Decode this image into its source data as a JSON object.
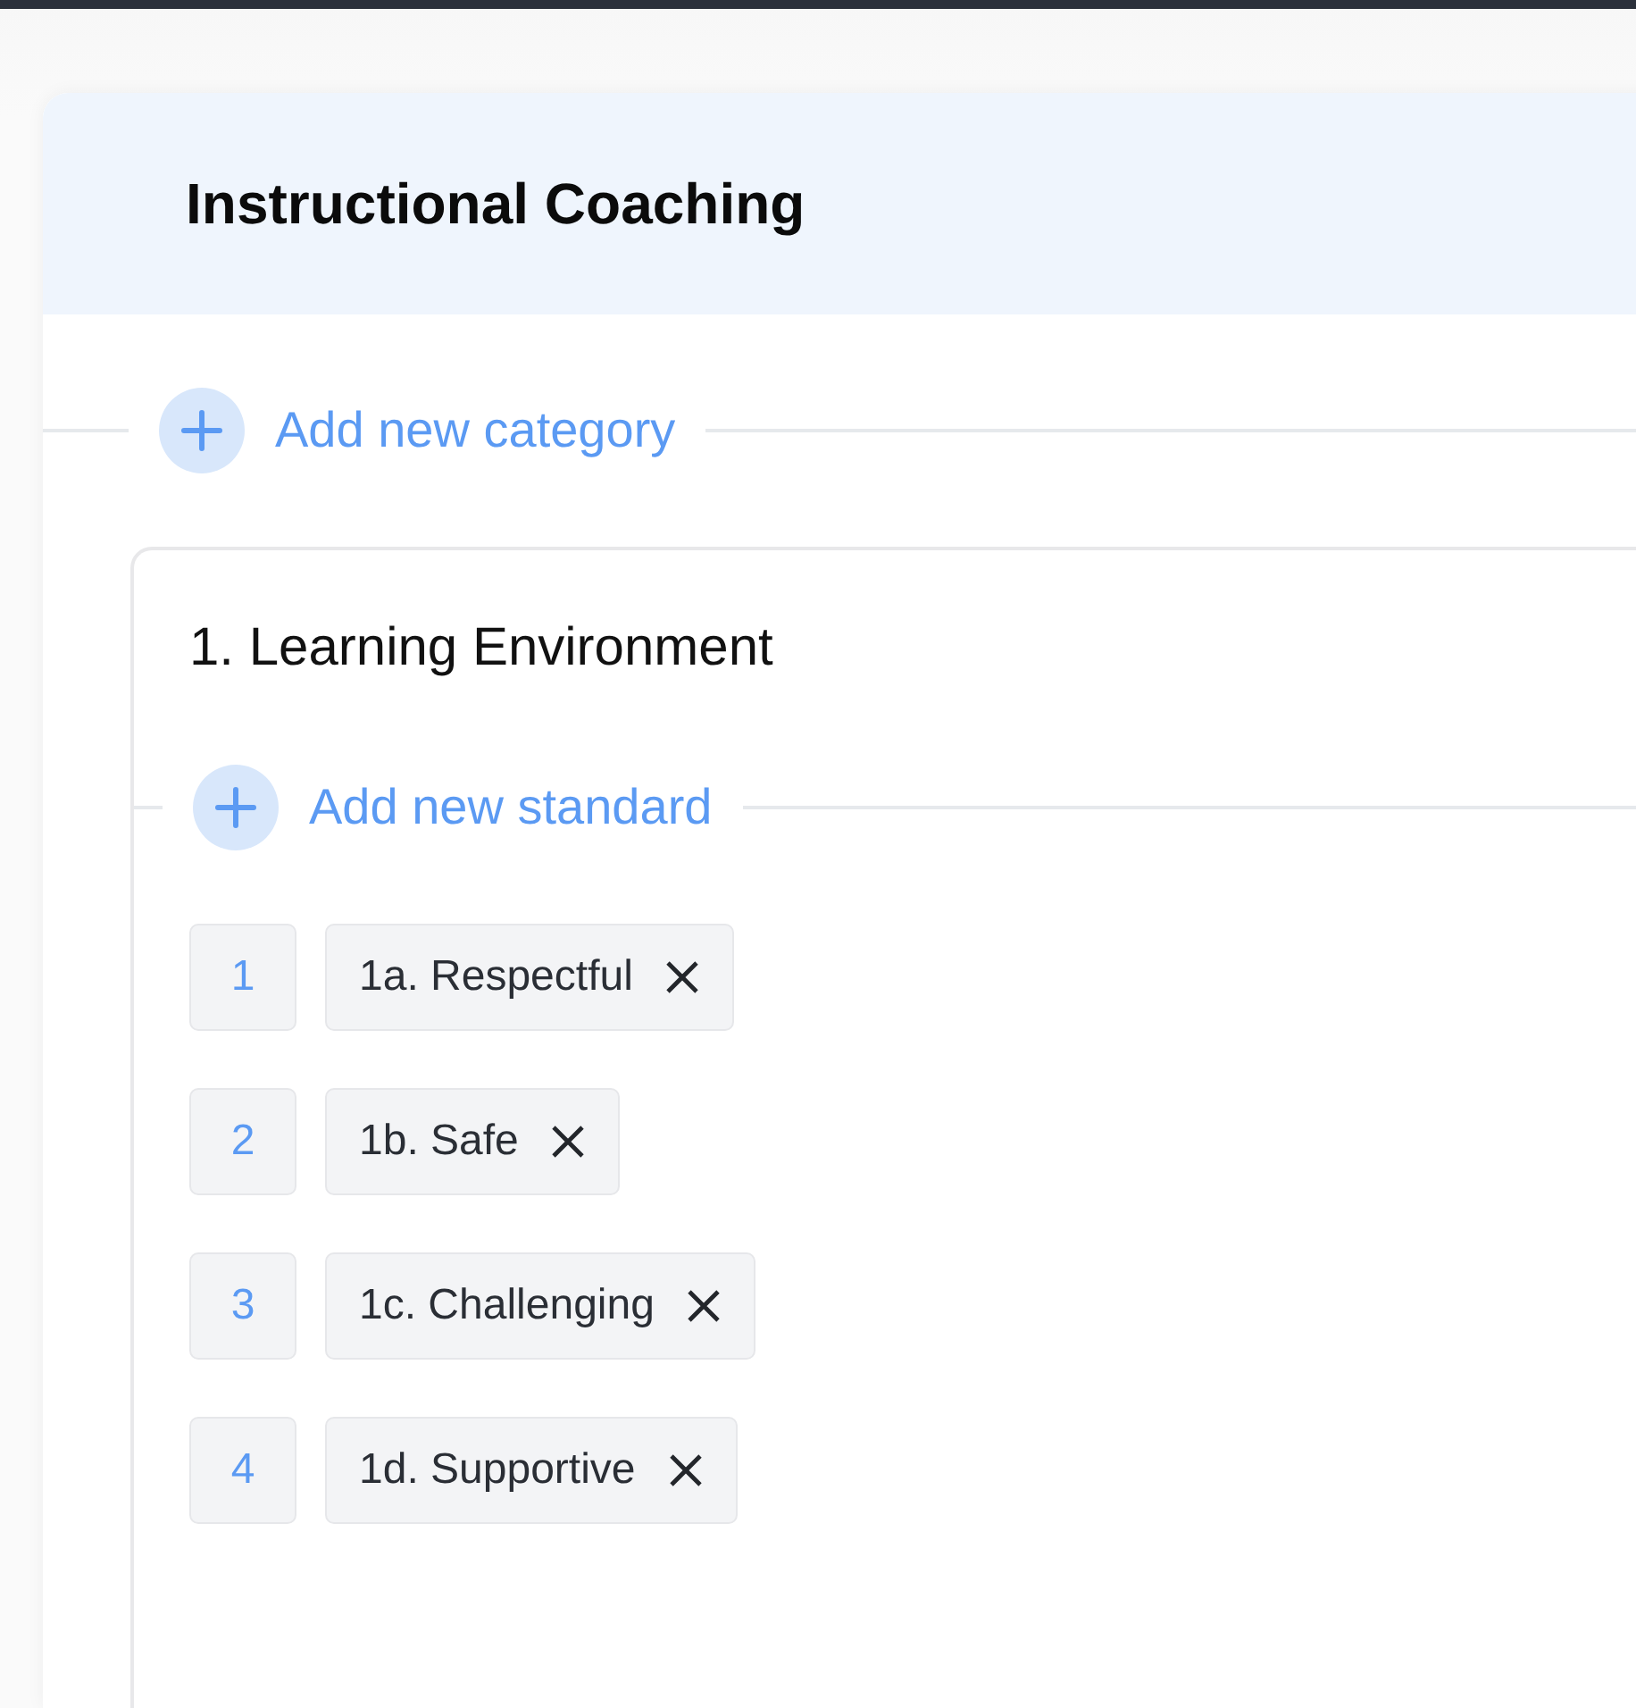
{
  "title": "Instructional Coaching",
  "add_category": {
    "label": "Add new category"
  },
  "category": {
    "title": "1. Learning Environment",
    "add_standard": {
      "label": "Add new standard"
    },
    "standards": [
      {
        "number": "1",
        "label": "1a. Respectful"
      },
      {
        "number": "2",
        "label": "1b. Safe"
      },
      {
        "number": "3",
        "label": "1c. Challenging"
      },
      {
        "number": "4",
        "label": "1d. Supportive"
      }
    ]
  }
}
